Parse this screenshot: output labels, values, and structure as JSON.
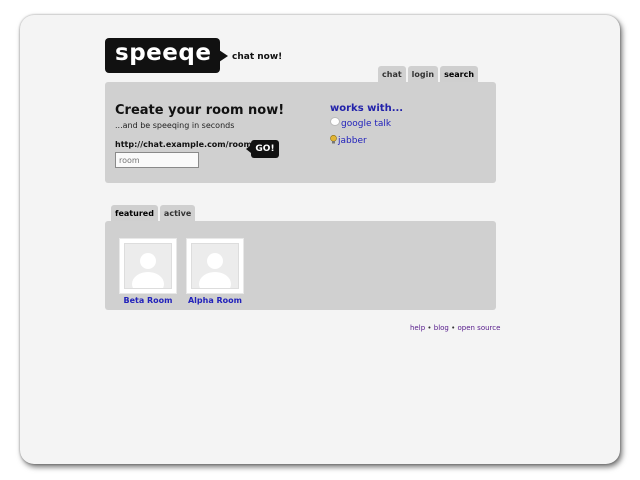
{
  "brand": {
    "logo": "speeqe",
    "tagline": "chat now!"
  },
  "nav_tabs": [
    "chat",
    "login",
    "search"
  ],
  "create_room": {
    "title": "Create your room now!",
    "subtitle": "...and be speeqing in seconds",
    "url_prefix": "http://chat.example.com/room/",
    "input_placeholder": "room",
    "go_label": "GO!"
  },
  "works_with": {
    "title": "works with...",
    "clients": [
      {
        "label": "google talk",
        "icon": "speech-bubble-icon"
      },
      {
        "label": "jabber",
        "icon": "lightbulb-icon"
      }
    ]
  },
  "room_tabs": [
    "featured",
    "active"
  ],
  "rooms": [
    {
      "name": "Beta Room",
      "icon": "user-avatar-icon"
    },
    {
      "name": "Alpha Room",
      "icon": "user-avatar-icon"
    }
  ],
  "footer": {
    "links": [
      "help",
      "blog",
      "open source"
    ],
    "separator": "•"
  },
  "colors": {
    "logo_bg": "#111111",
    "panel_bg": "#d0d0d0",
    "link": "#2222bb",
    "visited": "#551a8b"
  }
}
